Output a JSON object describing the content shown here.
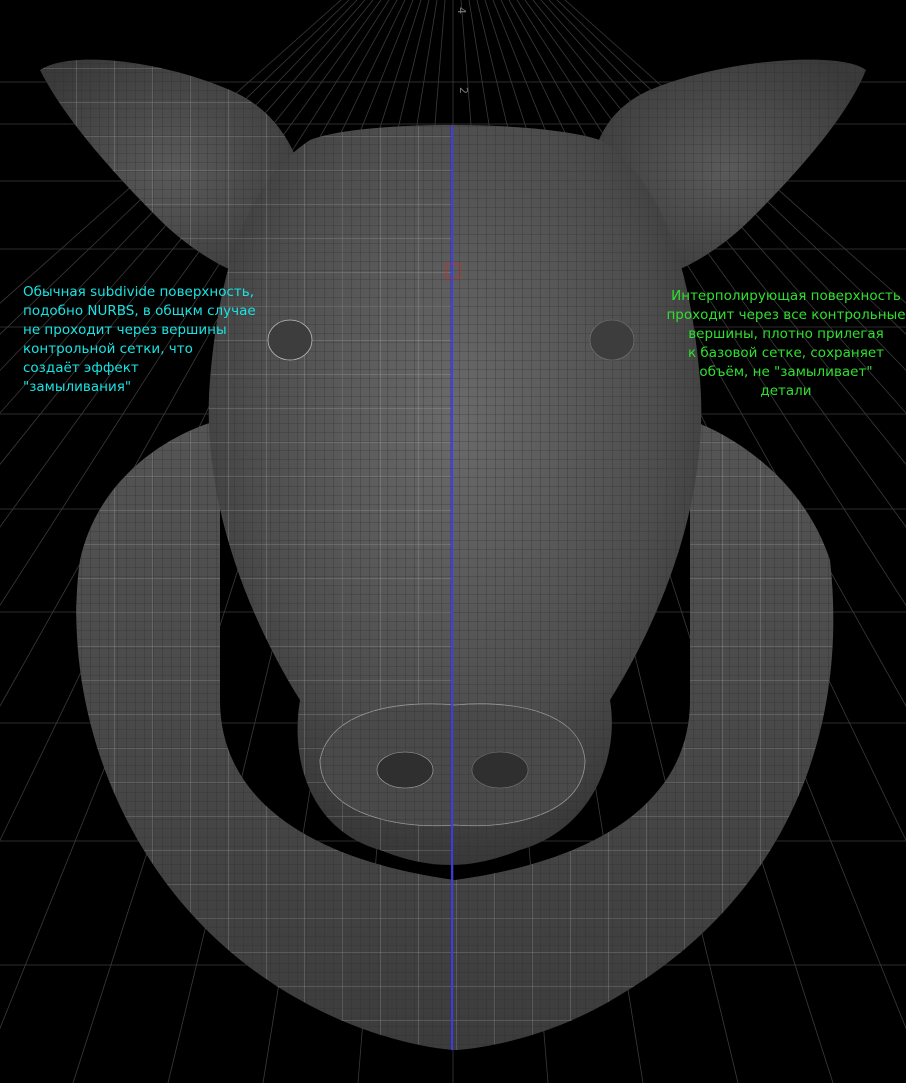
{
  "viewport": {
    "background_color": "#000000",
    "grid_color": "#3a3a3a",
    "mesh_color": "#5a5a5a",
    "wire_color": "#cfcfcf",
    "symmetry_line_color": "#3b3bff",
    "axis_ticks": [
      "4",
      "2"
    ]
  },
  "annotations": {
    "left": {
      "text": "Обычная subdivide поверхность,\nподобно NURBS, в общкм случае\nне проходит через вершины\nконтрольной сетки, что\nсоздаёт эффект\n\"замыливания\"",
      "color": "#19e3e3"
    },
    "right": {
      "text": "Интерполирующая поверхность\nпроходит через все контрольные\nвершины, плотно прилегая\nк базовой сетке, сохраняет\nобъём, не \"замыливает\"\nдетали",
      "color": "#2fe02f"
    }
  }
}
